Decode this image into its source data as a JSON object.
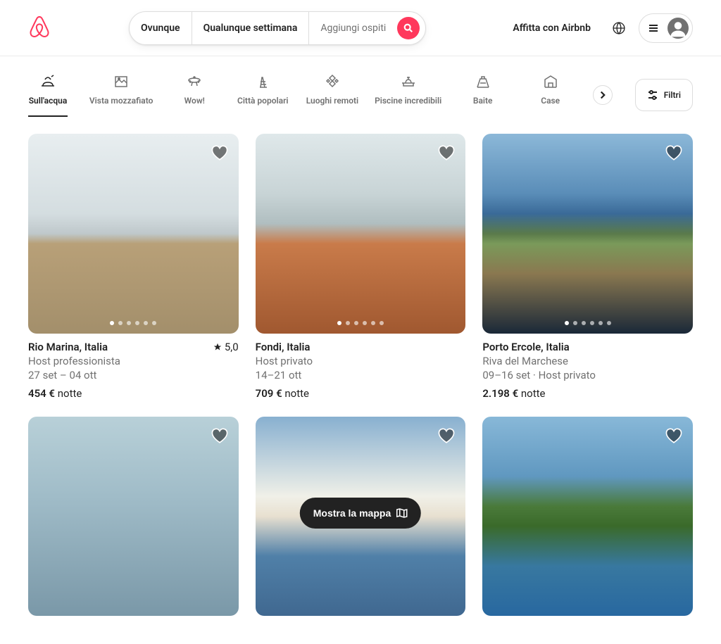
{
  "header": {
    "search": {
      "where": "Ovunque",
      "when": "Qualunque settimana",
      "guests": "Aggiungi ospiti"
    },
    "host_link": "Affitta con Airbnb"
  },
  "categories": [
    {
      "label": "Sull'acqua",
      "active": true
    },
    {
      "label": "Vista mozzafiato",
      "active": false
    },
    {
      "label": "Wow!",
      "active": false
    },
    {
      "label": "Città popolari",
      "active": false
    },
    {
      "label": "Luoghi remoti",
      "active": false
    },
    {
      "label": "Piscine incredibili",
      "active": false
    },
    {
      "label": "Baite",
      "active": false
    },
    {
      "label": "Case",
      "active": false
    }
  ],
  "filters_label": "Filtri",
  "listings": [
    {
      "title": "Rio Marina, Italia",
      "rating": "5,0",
      "sub1": "Host professionista",
      "sub2": "27 set – 04 ott",
      "price": "454 €",
      "price_unit": " notte",
      "bg": "bg1",
      "dots": 6
    },
    {
      "title": "Fondi, Italia",
      "rating": null,
      "sub1": "Host privato",
      "sub2": "14–21 ott",
      "price": "709 €",
      "price_unit": " notte",
      "bg": "bg2",
      "dots": 6
    },
    {
      "title": "Porto Ercole, Italia",
      "rating": null,
      "sub1": "Riva del Marchese",
      "sub2": "09–16 set · Host privato",
      "price": "2.198 €",
      "price_unit": " notte",
      "bg": "bg3",
      "dots": 6
    },
    {
      "title": "",
      "bg": "bg4",
      "partial": true
    },
    {
      "title": "",
      "bg": "bg5",
      "partial": true
    },
    {
      "title": "",
      "bg": "bg6",
      "partial": true
    }
  ],
  "map_button": "Mostra la mappa"
}
